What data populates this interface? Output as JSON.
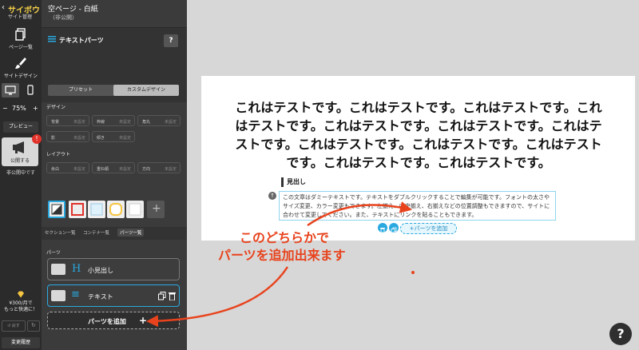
{
  "app": {
    "brand": "サイボウ",
    "back_label": "サイト管理"
  },
  "rail": {
    "pages_label": "ページ一覧",
    "design_label": "サイトデザイン",
    "zoom_minus": "−",
    "zoom_value": "75%",
    "zoom_plus": "+",
    "preview_label": "プレビュー",
    "publish_label": "公開する",
    "publish_badge": "!",
    "publish_state": "非公開中です",
    "plan_line1": "¥300/月で",
    "plan_line2": "もっと快適に！",
    "undo_label": "戻す",
    "history_label": "変更履歴"
  },
  "panel": {
    "page_title": "空ページ - 白紙",
    "page_state": "（非公開）",
    "part_title": "テキストパーツ",
    "help": "?",
    "tabs": [
      "プリセット",
      "カスタムデザイン"
    ],
    "design_label": "デザイン",
    "design_props": [
      {
        "key": "背景",
        "value": "未設定"
      },
      {
        "key": "枠線",
        "value": "未設定"
      },
      {
        "key": "角丸",
        "value": "未設定"
      },
      {
        "key": "影",
        "value": "未設定"
      },
      {
        "key": "傾き",
        "value": "未設定"
      }
    ],
    "layout_label": "レイアウト",
    "layout_props": [
      {
        "key": "余白",
        "value": "未設定"
      },
      {
        "key": "重ね順",
        "value": "未設定"
      },
      {
        "key": "方向",
        "value": "未設定"
      }
    ],
    "bottom_tabs": [
      "セクション一覧",
      "コンテナ一覧",
      "パーツ一覧"
    ],
    "parts_label": "パーツ",
    "parts": [
      {
        "icon": "H",
        "label": "小見出し"
      },
      {
        "icon": "≡",
        "label": "テキスト"
      }
    ],
    "add_part_label": "パーツを追加",
    "add_part_plus": "+"
  },
  "canvas": {
    "hero_text": "これはテストです。これはテストです。これはテストです。これはテストです。これはテストです。これはテストです。これはテストです。これはテストです。これはテストです。これはテストです。これはテストです。これはテストです。",
    "heading": "見出し",
    "body": "この文章はダミーテキストです。テキストをダブルクリックすることで編集が可能です。フォントの太さやサイズ変更、カラー変更もできます。左揃え、中央揃え、右揃えなどの位置調整もできますので、サイトに合わせて変更してください。また、テキストにリンクを貼ることもできます。",
    "up": "↑",
    "add_inline_label": "+パーツを追加"
  },
  "annotation": {
    "line1": "このどちらかで",
    "line2": "パーツを追加出来ます"
  },
  "help_fab": "?",
  "colors": {
    "accent": "#29a9e0",
    "annotation": "#e8431d",
    "badge": "#e0322a"
  }
}
